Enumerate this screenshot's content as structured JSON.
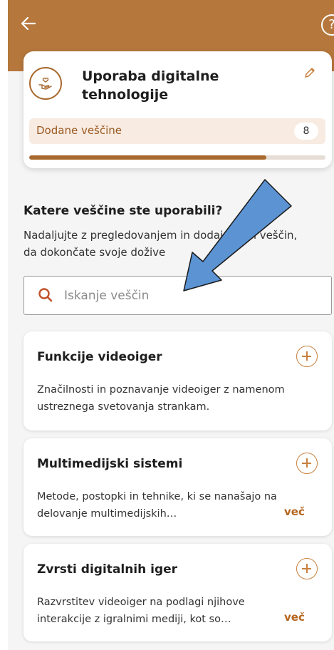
{
  "header": {
    "back_icon": "arrow-left-icon",
    "help_icon": "help-circle-icon",
    "help_glyph": "?"
  },
  "skill_card": {
    "title": "Uporaba digitalne tehnologije",
    "icon": "hand-heart-icon",
    "edit_icon": "pencil-icon",
    "added_label": "Dodane veščine",
    "added_count": "8",
    "progress": 0.8
  },
  "question": {
    "title": "Katere veščine ste uporabili?",
    "description": "Nadaljujte z pregledovanjem in dodajanjem veščin, da dokončate svoje dožive"
  },
  "search": {
    "placeholder": "Iskanje veščin",
    "value": ""
  },
  "items": [
    {
      "title": "Funkcije videoiger",
      "description": "Značilnosti in poznavanje videoiger z namenom ustreznega svetovanja strankam."
    },
    {
      "title": "Multimedijski sistemi",
      "description": "Metode, postopki in tehnike, ki se nanašajo na delovanje multimedijskih…",
      "more": "več"
    },
    {
      "title": "Zvrsti digitalnih iger",
      "description": "Razvrstitev videoiger na podlagi njihove interakcije z igralnimi mediji, kot so…",
      "more": "več"
    }
  ],
  "colors": {
    "brand": "#b5773c",
    "accent": "#c8803e",
    "annotation_arrow": "#5b93d3"
  }
}
